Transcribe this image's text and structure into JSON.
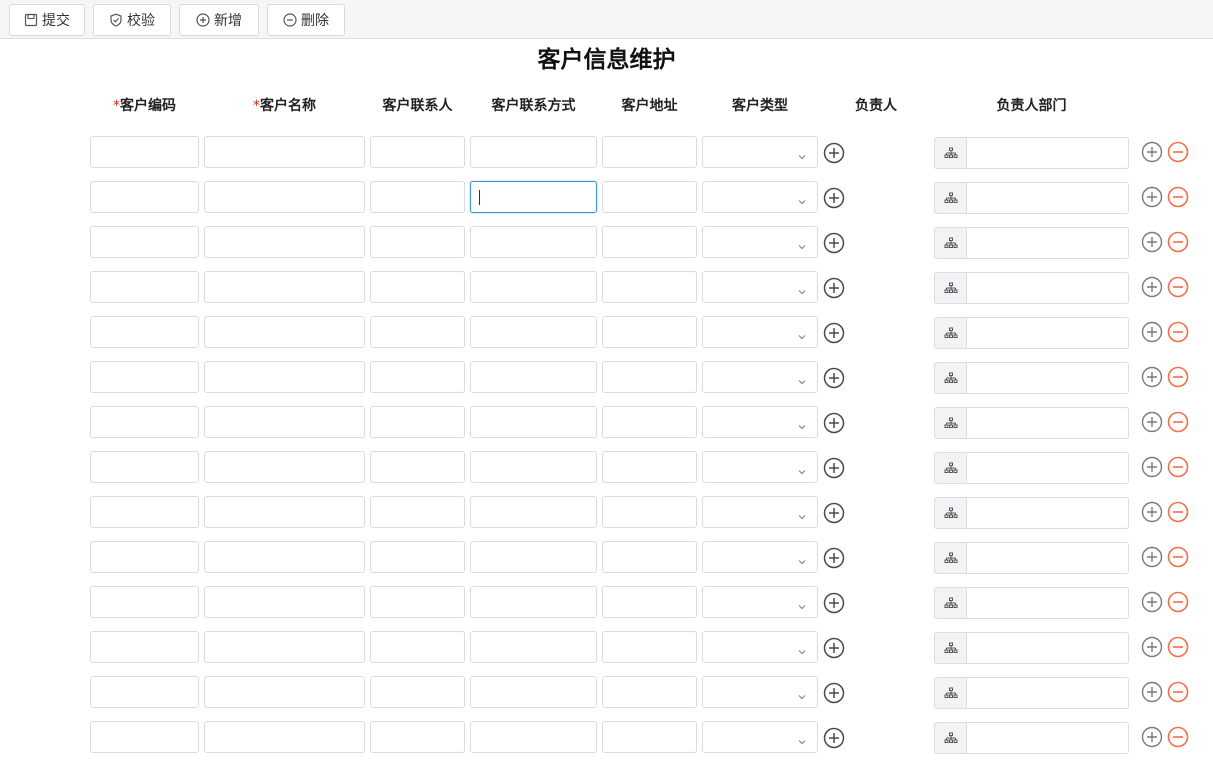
{
  "toolbar": {
    "buttons": [
      {
        "label": "提交",
        "icon": "save-icon"
      },
      {
        "label": "校验",
        "icon": "shield-check-icon"
      },
      {
        "label": "新增",
        "icon": "add-circle-icon"
      },
      {
        "label": "删除",
        "icon": "remove-circle-icon"
      }
    ]
  },
  "form": {
    "title": "客户信息维护",
    "required_marker": "*",
    "columns": [
      {
        "label": "客户编码",
        "required": true
      },
      {
        "label": "客户名称",
        "required": true
      },
      {
        "label": "客户联系人",
        "required": false
      },
      {
        "label": "客户联系方式",
        "required": false
      },
      {
        "label": "客户地址",
        "required": false
      },
      {
        "label": "客户类型",
        "required": false
      },
      {
        "label": "负责人",
        "required": false
      },
      {
        "label": "负责人部门",
        "required": false
      }
    ],
    "row_count": 14,
    "focused_row": 2,
    "focused_field": "客户联系方式"
  },
  "colors": {
    "focus_border": "#3a8ee6",
    "delete_accent": "#f56c4a",
    "required_marker": "#e02020"
  },
  "icons": {
    "select_arrow": "chevron-down-icon",
    "person_add": "add-circle-icon",
    "dept_picker": "org-tree-icon",
    "row_add": "plus-circle-icon",
    "row_delete": "minus-circle-icon"
  }
}
